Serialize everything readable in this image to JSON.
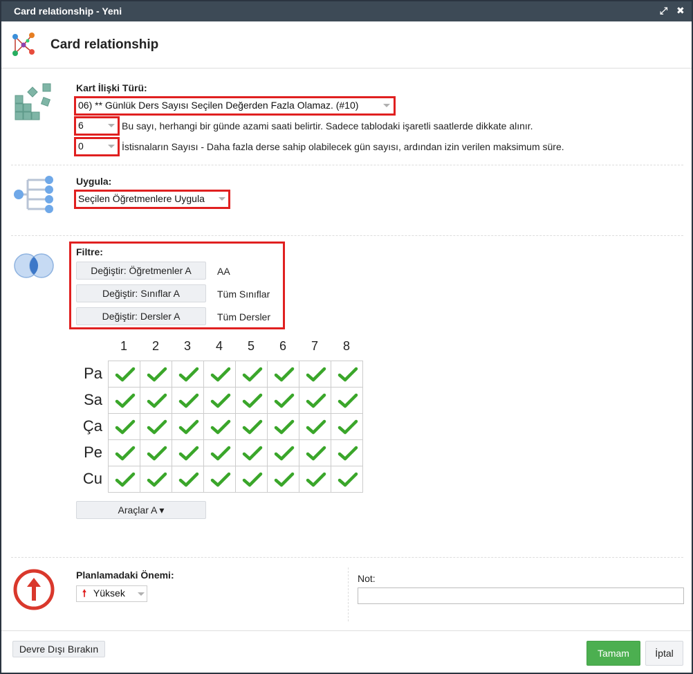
{
  "window": {
    "title": "Card relationship - Yeni",
    "heading": "Card relationship"
  },
  "relation": {
    "label": "Kart İlişki Türü:",
    "type_value": "06) ** Günlük Ders Sayısı Seçilen Değerden Fazla Olamaz. (#10)",
    "max_value": "6",
    "max_hint": "Bu sayı, herhangi bir günde azami saati belirtir. Sadece tablodaki işaretli saatlerde dikkate alınır.",
    "exceptions_value": "0",
    "exceptions_hint": "İstisnaların Sayısı - Daha fazla derse sahip olabilecek gün sayısı, ardından izin verilen maksimum süre."
  },
  "apply": {
    "label": "Uygula:",
    "value": "Seçilen Öğretmenlere Uygula"
  },
  "filter": {
    "label": "Filtre:",
    "rows": [
      {
        "button": "Değiştir: Öğretmenler A",
        "value": "AA"
      },
      {
        "button": "Değiştir: Sınıflar A",
        "value": "Tüm Sınıflar"
      },
      {
        "button": "Değiştir: Dersler A",
        "value": "Tüm Dersler"
      }
    ]
  },
  "grid": {
    "columns": [
      "1",
      "2",
      "3",
      "4",
      "5",
      "6",
      "7",
      "8"
    ],
    "rows": [
      "Pa",
      "Sa",
      "Ça",
      "Pe",
      "Cu"
    ],
    "checked": [
      [
        true,
        true,
        true,
        true,
        true,
        true,
        true,
        true
      ],
      [
        true,
        true,
        true,
        true,
        true,
        true,
        true,
        true
      ],
      [
        true,
        true,
        true,
        true,
        true,
        true,
        true,
        true
      ],
      [
        true,
        true,
        true,
        true,
        true,
        true,
        true,
        true
      ],
      [
        true,
        true,
        true,
        true,
        true,
        true,
        true,
        true
      ]
    ],
    "check_color": "#3aa62a"
  },
  "tools_button": "Araçlar A ▾",
  "importance": {
    "label": "Planlamadaki Önemi:",
    "value": "Yüksek"
  },
  "note": {
    "label": "Not:",
    "value": ""
  },
  "footer": {
    "disable_button": "Devre Dışı Bırakın",
    "ok_button": "Tamam",
    "cancel_button": "İptal"
  },
  "colors": {
    "titlebar": "#3d4a56",
    "highlight": "#e02020",
    "ok_green": "#4caf50",
    "importance_red": "#d9382c"
  },
  "icons": {
    "header": "network-icon",
    "relation": "blocks-icon",
    "apply": "tree-icon",
    "filter": "venn-icon",
    "importance": "arrow-up-circle-icon",
    "expand": "expand-icon",
    "close": "close-icon"
  }
}
